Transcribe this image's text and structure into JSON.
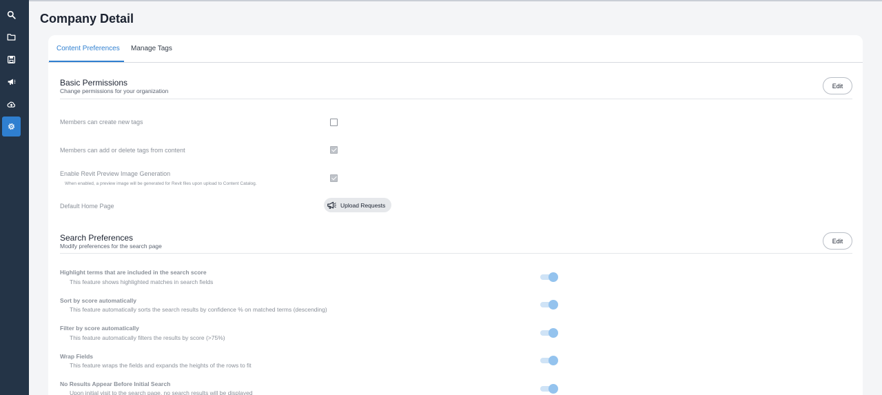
{
  "sidebar": {
    "items": [
      {
        "icon": "search-icon",
        "active": false
      },
      {
        "icon": "folder-icon",
        "active": false
      },
      {
        "icon": "save-icon",
        "active": false
      },
      {
        "icon": "megaphone-icon",
        "active": false
      },
      {
        "icon": "cloud-upload-icon",
        "active": false
      },
      {
        "icon": "gear-icon",
        "active": true
      }
    ]
  },
  "page": {
    "title": "Company Detail"
  },
  "tabs": [
    {
      "label": "Content Preferences",
      "active": true
    },
    {
      "label": "Manage Tags",
      "active": false
    }
  ],
  "basic_permissions": {
    "title": "Basic Permissions",
    "subtitle": "Change permissions for your organization",
    "edit_label": "Edit",
    "items": [
      {
        "label": "Members can create new tags",
        "checked": false
      },
      {
        "label": "Members can add or delete tags from content",
        "checked": true
      },
      {
        "label": "Enable Revit Preview Image Generation",
        "note": "When enabled, a preview image will be generated for Revit files upon upload to Content Catalog.",
        "checked": true
      }
    ],
    "default_home": {
      "label": "Default Home Page",
      "value": "Upload Requests",
      "icon": "megaphone-icon"
    }
  },
  "search_preferences": {
    "title": "Search Preferences",
    "subtitle": "Modify preferences for the search page",
    "edit_label": "Edit",
    "items": [
      {
        "title": "Highlight terms that are included in the search score",
        "desc": "This feature shows highlighted matches in search fields",
        "on": true
      },
      {
        "title": "Sort by score automatically",
        "desc": "This feature automatically sorts the search results by confidence % on matched terms (descending)",
        "on": true
      },
      {
        "title": "Filter by score automatically",
        "desc": "This feature automatically filters the results by score (>75%)",
        "on": true
      },
      {
        "title": "Wrap Fields",
        "desc": "This feature wraps the fields and expands the heights of the rows to fit",
        "on": true
      },
      {
        "title": "No Results Appear Before Initial Search",
        "desc": "Upon initial visit to the search page, no search results will be displayed",
        "on": true
      }
    ]
  },
  "colors": {
    "sidebar": "#243447",
    "accent": "#2f7fd0",
    "toggle_on": "#94c3ee"
  }
}
